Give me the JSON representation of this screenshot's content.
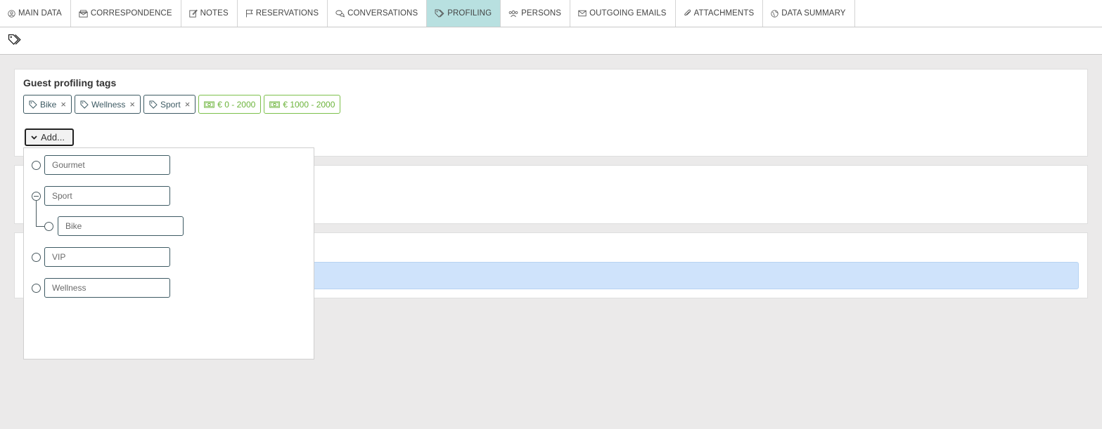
{
  "tabs": [
    {
      "label": "MAIN DATA",
      "icon": "user-circle-icon",
      "active": false
    },
    {
      "label": "CORRESPONDENCE",
      "icon": "envelope-open-icon",
      "active": false
    },
    {
      "label": "NOTES",
      "icon": "edit-icon",
      "active": false
    },
    {
      "label": "RESERVATIONS",
      "icon": "flag-icon",
      "active": false
    },
    {
      "label": "CONVERSATIONS",
      "icon": "chat-bubbles-icon",
      "active": false
    },
    {
      "label": "PROFILING",
      "icon": "tags-icon",
      "active": true
    },
    {
      "label": "PERSONS",
      "icon": "users-icon",
      "active": false
    },
    {
      "label": "OUTGOING EMAILS",
      "icon": "envelope-icon",
      "active": false
    },
    {
      "label": "ATTACHMENTS",
      "icon": "paperclip-icon",
      "active": false
    },
    {
      "label": "DATA SUMMARY",
      "icon": "globe-icon",
      "active": false
    }
  ],
  "toolbar": {
    "icon": "tags-icon"
  },
  "profiling": {
    "title": "Guest profiling tags",
    "tags": [
      {
        "label": "Bike",
        "icon": "tag-icon",
        "removable": true,
        "color": "#3d5a63"
      },
      {
        "label": "Wellness",
        "icon": "tag-icon",
        "removable": true,
        "color": "#3d5a63"
      },
      {
        "label": "Sport",
        "icon": "tag-icon",
        "removable": true,
        "color": "#3d5a63"
      },
      {
        "label": "€ 0 - 2000",
        "icon": "money-icon",
        "removable": false,
        "color": "#6bb33a"
      },
      {
        "label": "€ 1000 - 2000",
        "icon": "money-icon",
        "removable": false,
        "color": "#6bb33a"
      }
    ],
    "remove_glyph": "×",
    "add_label": "Add..."
  },
  "dropdown": {
    "options": [
      {
        "label": "Gourmet",
        "level": 0,
        "expanded": false
      },
      {
        "label": "Sport",
        "level": 0,
        "expanded": true
      },
      {
        "label": "Bike",
        "level": 1,
        "expanded": false
      },
      {
        "label": "VIP",
        "level": 0,
        "expanded": false
      },
      {
        "label": "Wellness",
        "level": 0,
        "expanded": false
      }
    ]
  },
  "colors": {
    "active_tab": "#b8e0e0",
    "info_bar": "#cfe3fb",
    "accent_green": "#6bb33a"
  }
}
